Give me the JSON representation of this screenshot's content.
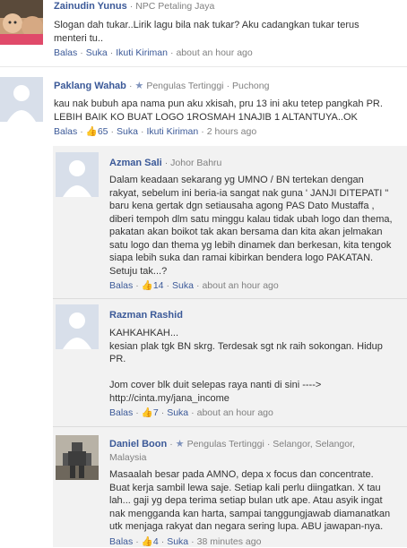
{
  "comments": [
    {
      "name": "Zainudin Yunus",
      "location": "NPC Petaling Jaya",
      "body": "Slogan dah tukar..Lirik lagu bila nak tukar? Aku cadangkan tukar terus\nmenteri tu..",
      "actions": {
        "reply": "Balas",
        "like": "Suka",
        "follow": "Ikuti Kiriman",
        "time": "about an hour ago"
      }
    },
    {
      "name": "Paklang Wahab",
      "badge": "Pengulas Tertinggi",
      "location": "Puchong",
      "body": "kau nak bubuh apa nama pun aku xkisah, pru 13 ini aku tetep pangkah PR.\nLEBIH BAIK KO BUAT LOGO 1ROSMAH 1NAJIB 1 ALTANTUYA..OK",
      "actions": {
        "reply": "Balas",
        "likes": "65",
        "like": "Suka",
        "follow": "Ikuti Kiriman",
        "time": "2 hours ago"
      }
    }
  ],
  "replies": [
    {
      "name": "Azman Sali",
      "location": "Johor Bahru",
      "body": "Dalam keadaan sekarang yg UMNO / BN tertekan dengan\nrakyat, sebelum ini beria-ia sangat nak guna ' JANJI DITEPATI \"\nbaru kena gertak dgn setiausaha agong PAS Dato Mustaffa ,\ndiberi tempoh dlm satu minggu kalau tidak ubah logo dan thema,\npakatan akan boikot tak akan bersama dan kita akan jelmakan\nsatu logo dan thema yg lebih dinamek dan berkesan, kita tengok\nsiapa lebih suka dan ramai kibirkan bendera logo PAKATAN.\nSetuju tak...?",
      "actions": {
        "reply": "Balas",
        "likes": "14",
        "like": "Suka",
        "time": "about an hour ago"
      }
    },
    {
      "name": "Razman Rashid",
      "body": "KAHKAHKAH...\nkesian plak tgk BN skrg. Terdesak sgt nk raih sokongan. Hidup\nPR.\n\nJom cover blk duit selepas raya nanti di sini ---->\nhttp://cinta.my/jana_income",
      "actions": {
        "reply": "Balas",
        "likes": "7",
        "like": "Suka",
        "time": "about an hour ago"
      }
    },
    {
      "name": "Daniel Boon",
      "badge": "Pengulas Tertinggi",
      "location": "Selangor, Selangor,",
      "location2": "Malaysia",
      "body": "Masaalah besar pada AMNO, depa x focus dan concentrate.\nBuat kerja sambil lewa saje. Setiap kali perlu diingatkan. X tau\nlah... gaji yg depa terima setiap bulan utk ape. Atau asyik ingat\nnak mengganda kan harta, sampai tanggungjawab diamanatkan\nutk menjaga rakyat dan negara sering lupa. ABU jawapan-nya.",
      "actions": {
        "reply": "Balas",
        "likes": "4",
        "like": "Suka",
        "time": "38 minutes ago"
      }
    }
  ],
  "colors": {
    "link": "#3b5998",
    "border": "#d8dfea",
    "reply_bg": "#f2f2f2",
    "muted": "#808080"
  }
}
